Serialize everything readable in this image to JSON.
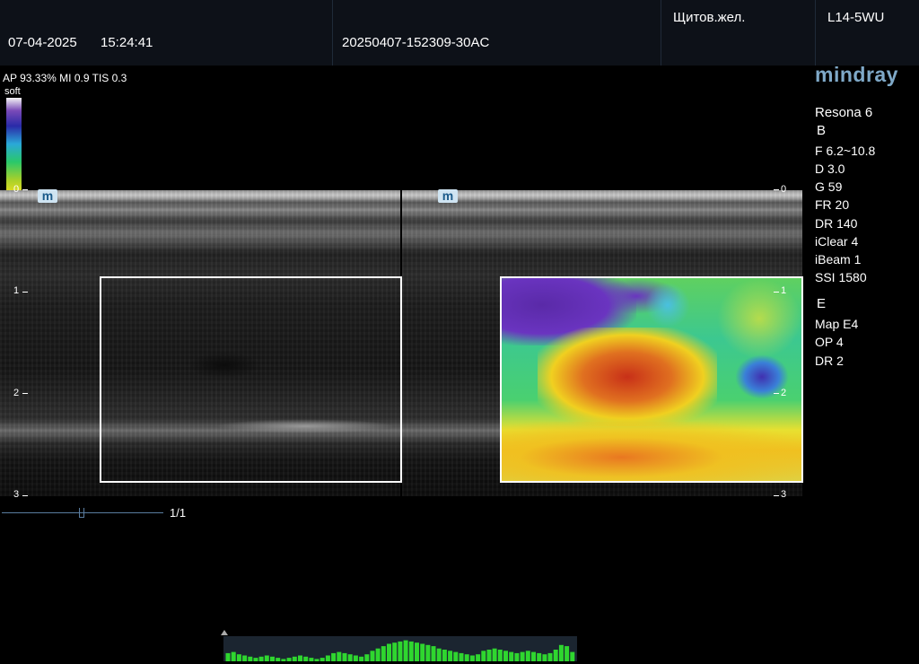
{
  "header": {
    "date": "07-04-2025",
    "time": "15:24:41",
    "exam_id": "20250407-152309-30AC",
    "organ": "Щитов.жел.",
    "probe": "L14-5WU"
  },
  "info_line": "AP 93.33%  MI 0.9 TIS 0.3",
  "colorbar": {
    "top_label": "soft",
    "bottom_label": "hard"
  },
  "brand": {
    "logo": "mindray",
    "model": "Resona 6"
  },
  "b_mode": {
    "label": "B",
    "params": [
      "F 6.2~10.8",
      "D 3.0",
      "G 59",
      "FR 20",
      "DR 140",
      "iClear 4",
      "iBeam 1",
      "SSI 1580"
    ]
  },
  "e_mode": {
    "label": "E",
    "params": [
      "Map E4",
      "OP 4",
      "DR 2"
    ]
  },
  "depth_marks": [
    "0",
    "1",
    "2",
    "3"
  ],
  "m_icon_label": "m",
  "frame_counter": "1/1",
  "histogram_levels": [
    0.35,
    0.4,
    0.3,
    0.25,
    0.2,
    0.15,
    0.2,
    0.25,
    0.2,
    0.15,
    0.1,
    0.15,
    0.2,
    0.25,
    0.2,
    0.15,
    0.1,
    0.15,
    0.25,
    0.35,
    0.4,
    0.35,
    0.3,
    0.25,
    0.2,
    0.3,
    0.45,
    0.55,
    0.65,
    0.75,
    0.8,
    0.85,
    0.9,
    0.85,
    0.8,
    0.75,
    0.7,
    0.65,
    0.55,
    0.5,
    0.45,
    0.4,
    0.35,
    0.3,
    0.25,
    0.3,
    0.45,
    0.5,
    0.55,
    0.5,
    0.45,
    0.4,
    0.35,
    0.4,
    0.45,
    0.4,
    0.35,
    0.3,
    0.35,
    0.5,
    0.7,
    0.65,
    0.4
  ],
  "colors": {
    "header_bg": "#0d1118",
    "logo": "#7fa9c8",
    "histogram_bar": "#2fd62f"
  }
}
